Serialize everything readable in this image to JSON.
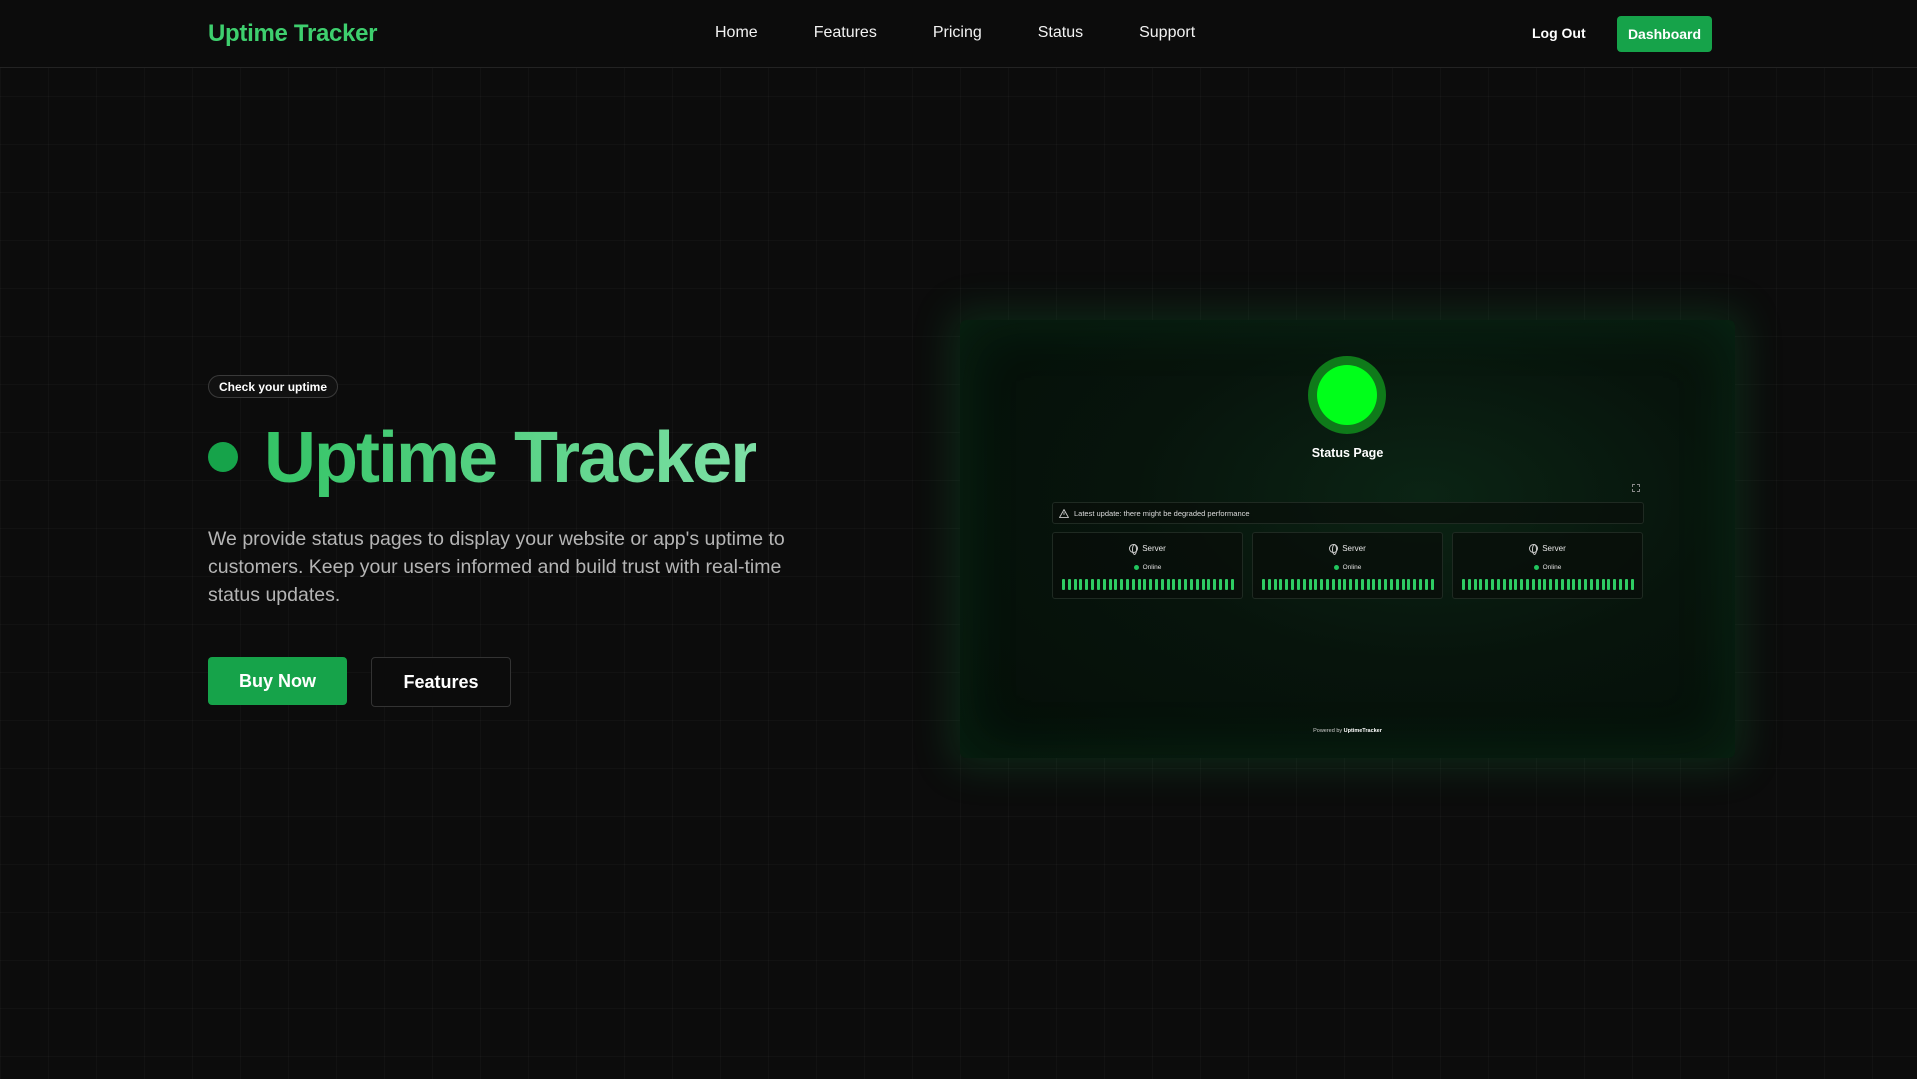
{
  "header": {
    "logo": "Uptime Tracker",
    "nav": [
      "Home",
      "Features",
      "Pricing",
      "Status",
      "Support"
    ],
    "logout": "Log Out",
    "dashboard": "Dashboard"
  },
  "hero": {
    "badge": "Check your uptime",
    "title": "Uptime Tracker",
    "description": "We provide status pages to display your website or app's uptime to customers. Keep your users informed and build trust with real-time status updates.",
    "buy_label": "Buy Now",
    "features_label": "Features"
  },
  "preview": {
    "page_title": "Status Page",
    "update_text": "Latest update: there might be degraded performance",
    "cards": [
      {
        "name": "Server",
        "status": "Online"
      },
      {
        "name": "Server",
        "status": "Online"
      },
      {
        "name": "Server",
        "status": "Online"
      }
    ],
    "powered_prefix": "Powered by",
    "powered_brand": "UptimeTracker"
  },
  "colors": {
    "accent": "#16a34a",
    "logo": "#3ecf6e",
    "status_online": "#00ff1a"
  }
}
